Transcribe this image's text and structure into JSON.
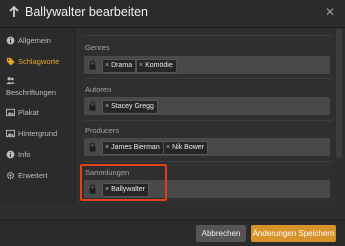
{
  "window": {
    "title": "Ballywalter bearbeiten"
  },
  "sidebar": {
    "items": [
      {
        "label": "Allgemein",
        "icon": "info-circle-icon"
      },
      {
        "label": "Schlagworte",
        "icon": "tag-icon",
        "active": true
      },
      {
        "label": "Beschriftungen",
        "icon": "users-icon"
      },
      {
        "label": "Plakat",
        "icon": "image-icon"
      },
      {
        "label": "Hintergrund",
        "icon": "image-icon"
      },
      {
        "label": "Info",
        "icon": "info-circle-icon"
      },
      {
        "label": "Erweitert",
        "icon": "gear-icon"
      }
    ]
  },
  "fields": {
    "genres": {
      "label": "Genres",
      "tags": [
        "Drama",
        "Komödie"
      ]
    },
    "authors": {
      "label": "Autoren",
      "tags": [
        "Stacey Gregg"
      ]
    },
    "producers": {
      "label": "Producers",
      "tags": [
        "James Bierman",
        "Nik Bower"
      ]
    },
    "collections": {
      "label": "Sammlungen",
      "tags": [
        "Ballywalter"
      ]
    }
  },
  "tag_remove_glyph": "×",
  "footer": {
    "cancel_label": "Abbrechen",
    "save_label": "Änderungen Speichern"
  },
  "colors": {
    "accent": "#d8922a",
    "active_nav": "#e0a92c",
    "highlight": "#e0401a"
  }
}
